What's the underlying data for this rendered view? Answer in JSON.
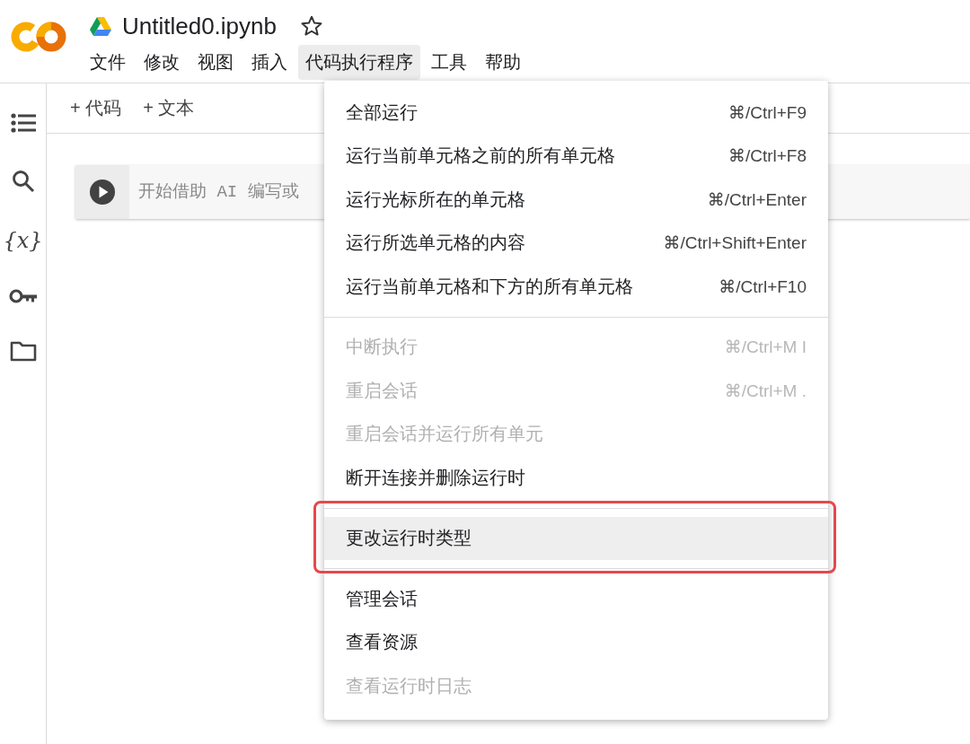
{
  "notebook": {
    "title": "Untitled0.ipynb",
    "starred": false
  },
  "menubar": [
    {
      "label": "文件",
      "selected": false
    },
    {
      "label": "修改",
      "selected": false
    },
    {
      "label": "视图",
      "selected": false
    },
    {
      "label": "插入",
      "selected": false
    },
    {
      "label": "代码执行程序",
      "selected": true
    },
    {
      "label": "工具",
      "selected": false
    },
    {
      "label": "帮助",
      "selected": false
    }
  ],
  "sidebar": [
    {
      "kind": "toc"
    },
    {
      "kind": "search"
    },
    {
      "kind": "glyph",
      "glyph": "{x}"
    },
    {
      "kind": "key"
    },
    {
      "kind": "folder"
    }
  ],
  "toolbar": [
    {
      "icon": "+",
      "label": "代码"
    },
    {
      "icon": "+",
      "label": "文本"
    }
  ],
  "cell": {
    "placeholder": "开始借助 AI 编写或"
  },
  "menu": {
    "sections": [
      [
        {
          "label": "全部运行",
          "shortcut": "⌘/Ctrl+F9",
          "disabled": false,
          "highlighted": false,
          "outlined": false
        },
        {
          "label": "运行当前单元格之前的所有单元格",
          "shortcut": "⌘/Ctrl+F8",
          "disabled": false,
          "highlighted": false,
          "outlined": false
        },
        {
          "label": "运行光标所在的单元格",
          "shortcut": "⌘/Ctrl+Enter",
          "disabled": false,
          "highlighted": false,
          "outlined": false
        },
        {
          "label": "运行所选单元格的内容",
          "shortcut": "⌘/Ctrl+Shift+Enter",
          "disabled": false,
          "highlighted": false,
          "outlined": false
        },
        {
          "label": "运行当前单元格和下方的所有单元格",
          "shortcut": "⌘/Ctrl+F10",
          "disabled": false,
          "highlighted": false,
          "outlined": false
        }
      ],
      [
        {
          "label": "中断执行",
          "shortcut": "⌘/Ctrl+M I",
          "disabled": true,
          "highlighted": false,
          "outlined": false
        },
        {
          "label": "重启会话",
          "shortcut": "⌘/Ctrl+M .",
          "disabled": true,
          "highlighted": false,
          "outlined": false
        },
        {
          "label": "重启会话并运行所有单元",
          "disabled": true,
          "highlighted": false,
          "outlined": false
        },
        {
          "label": "断开连接并删除运行时",
          "disabled": false,
          "highlighted": false,
          "outlined": false
        }
      ],
      [
        {
          "label": "更改运行时类型",
          "disabled": false,
          "highlighted": true,
          "outlined": true
        }
      ],
      [
        {
          "label": "管理会话",
          "disabled": false,
          "highlighted": false,
          "outlined": false
        },
        {
          "label": "查看资源",
          "disabled": false,
          "highlighted": false,
          "outlined": false
        },
        {
          "label": "查看运行时日志",
          "disabled": true,
          "highlighted": false,
          "outlined": false
        }
      ]
    ]
  }
}
